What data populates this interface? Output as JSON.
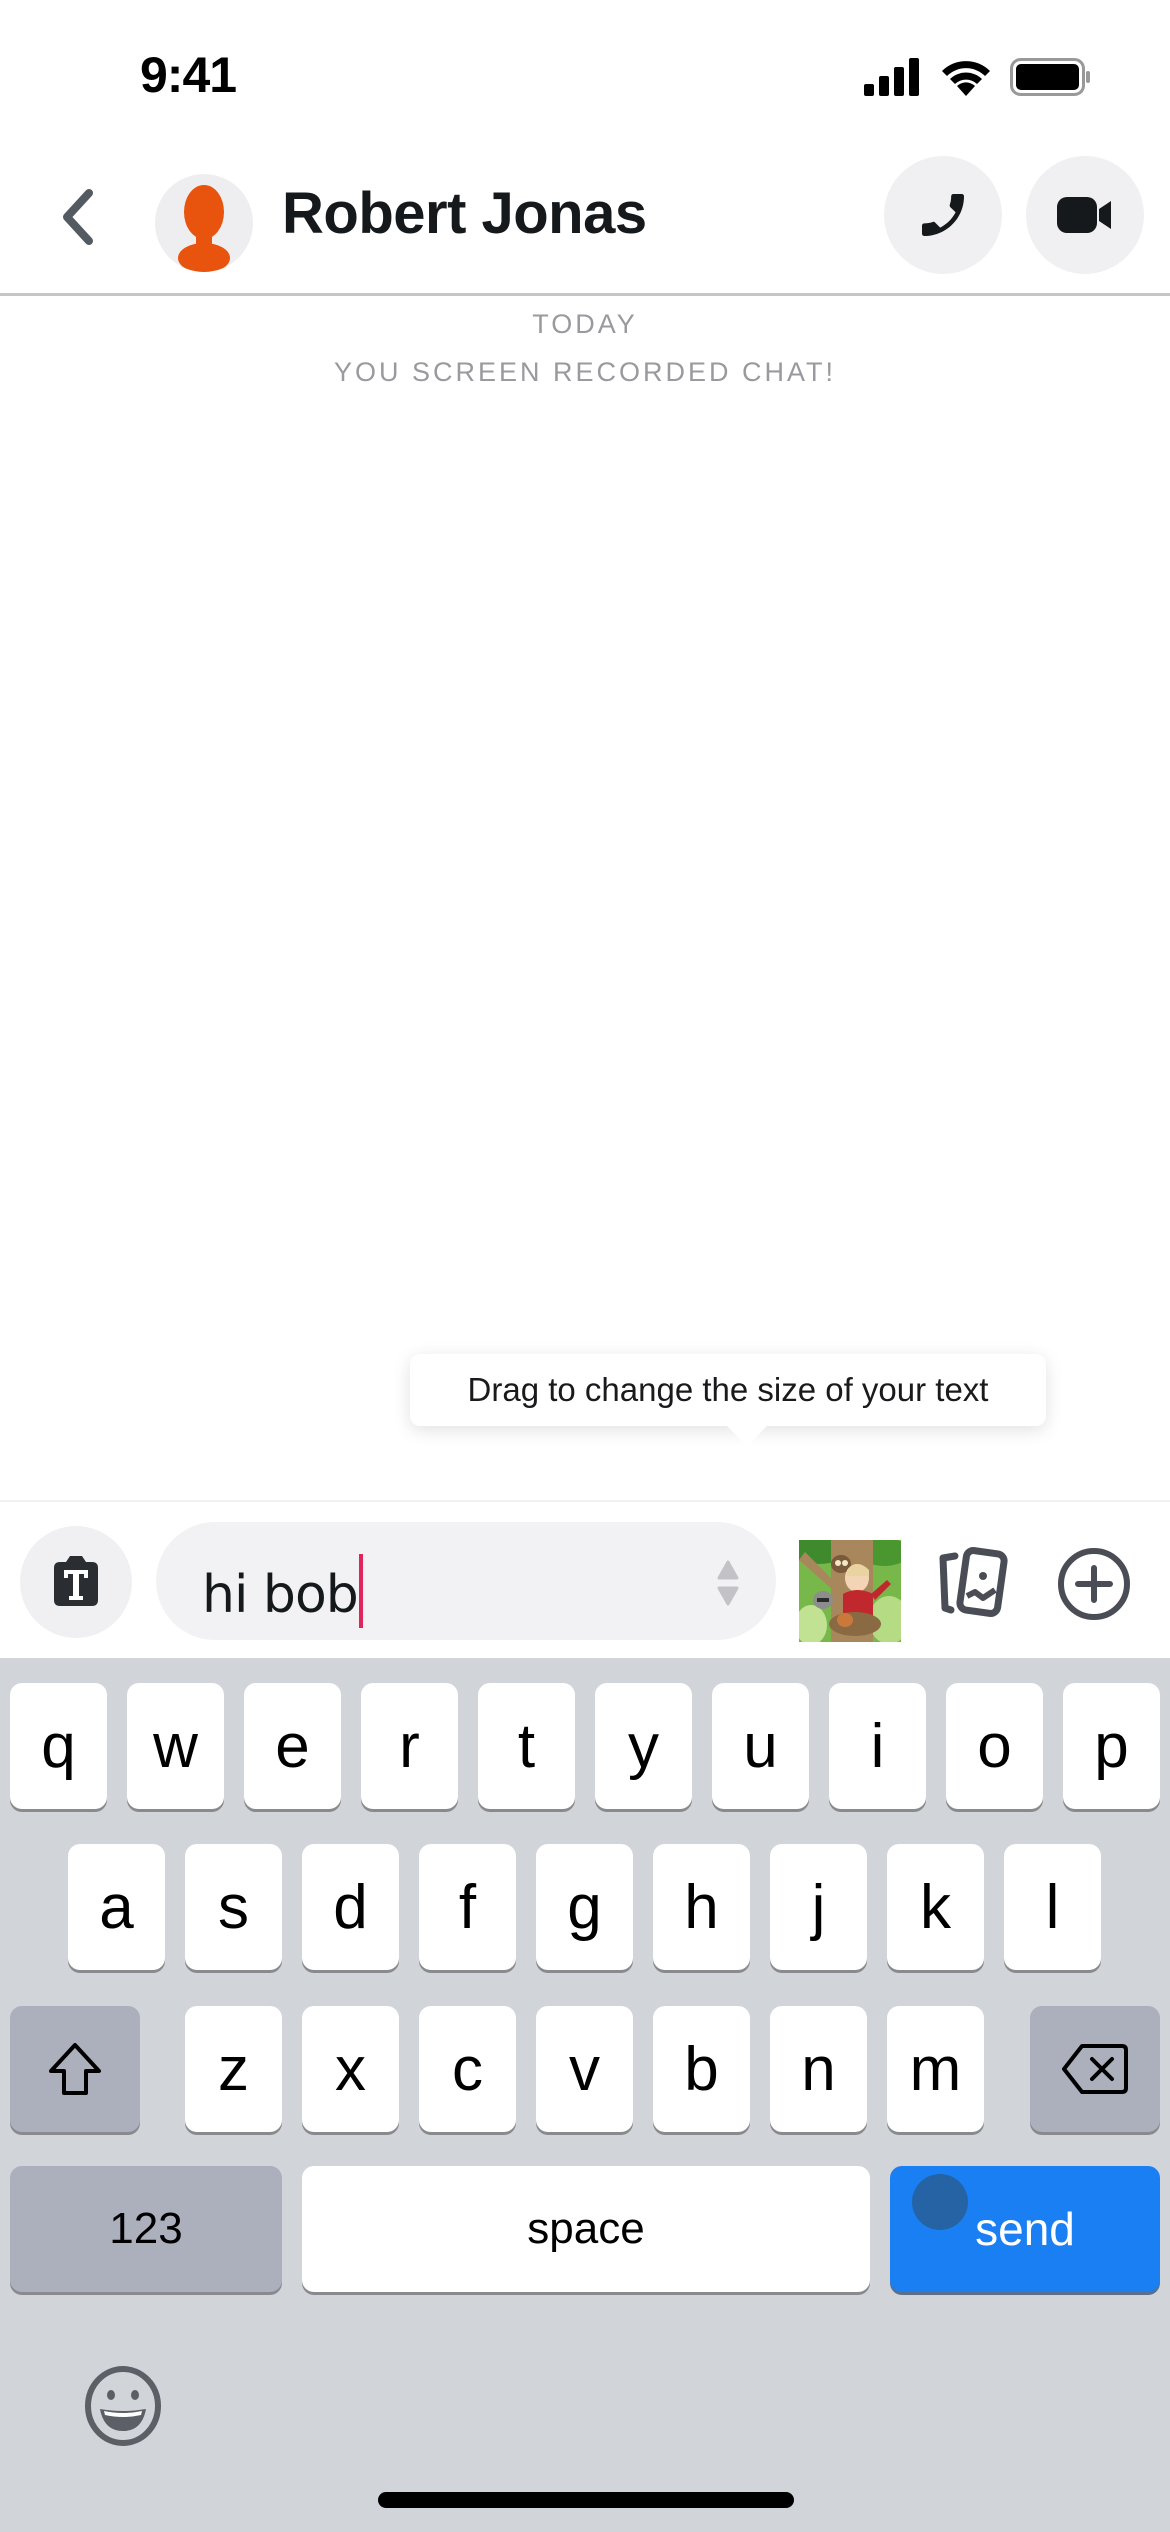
{
  "status_bar": {
    "time": "9:41",
    "icons": [
      "signal-icon",
      "wifi-icon",
      "battery-icon"
    ]
  },
  "header": {
    "back_icon": "chevron-left-icon",
    "contact_name": "Robert Jonas",
    "avatar_icon": "person-silhouette-icon",
    "avatar_color": "#e8530e",
    "call_icon": "phone-icon",
    "video_icon": "video-camera-icon"
  },
  "chat": {
    "date_label": "TODAY",
    "notice": "YOU SCREEN RECORDED CHAT!",
    "tooltip": "Drag to change the size of your text"
  },
  "compose": {
    "text_style_icon": "text-style-icon",
    "message_value": "hi bob",
    "size_handle_icon": "resize-handle-icon",
    "bitmoji_icon": "bitmoji-sticker-icon",
    "memories_icon": "memories-icon",
    "plus_icon": "plus-circle-icon",
    "caret_color": "#e0245e"
  },
  "keyboard": {
    "row1": [
      "q",
      "w",
      "e",
      "r",
      "t",
      "y",
      "u",
      "i",
      "o",
      "p"
    ],
    "row2": [
      "a",
      "s",
      "d",
      "f",
      "g",
      "h",
      "j",
      "k",
      "l"
    ],
    "row3": [
      "z",
      "x",
      "c",
      "v",
      "b",
      "n",
      "m"
    ],
    "shift_icon": "shift-icon",
    "delete_icon": "backspace-icon",
    "numbers_label": "123",
    "space_label": "space",
    "send_label": "send",
    "send_color": "#1a7ff2",
    "emoji_icon": "emoji-icon"
  }
}
